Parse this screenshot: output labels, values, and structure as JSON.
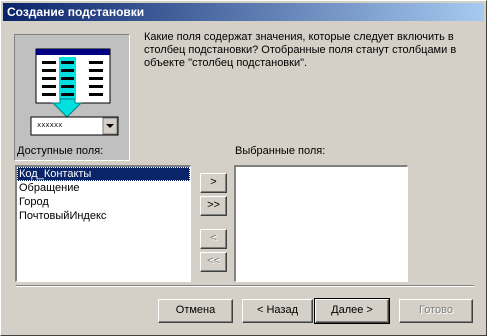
{
  "window": {
    "title": "Создание подстановки"
  },
  "description": "Какие поля содержат значения, которые следует включить в столбец подстановки? Отобранные поля станут столбцами в объекте \"столбец подстановки\".",
  "illustration": {
    "combo_text": "xxxxxx",
    "icon": "lookup-wizard-illustration"
  },
  "available": {
    "label": "Доступные поля:",
    "items": [
      "Код_Контакты",
      "Обращение",
      "Город",
      "ПочтовыйИндекс"
    ]
  },
  "selected": {
    "label": "Выбранные поля:",
    "items": []
  },
  "move_buttons": {
    "add_one": ">",
    "add_all": ">>",
    "remove_one": "<",
    "remove_all": "<<"
  },
  "footer": {
    "cancel": "Отмена",
    "back": "< Назад",
    "next": "Далее >",
    "finish": "Готово"
  },
  "colors": {
    "title_start": "#0a246a",
    "title_end": "#a6caf0",
    "selection": "#0a246a",
    "arrow": "#00e0e0"
  }
}
